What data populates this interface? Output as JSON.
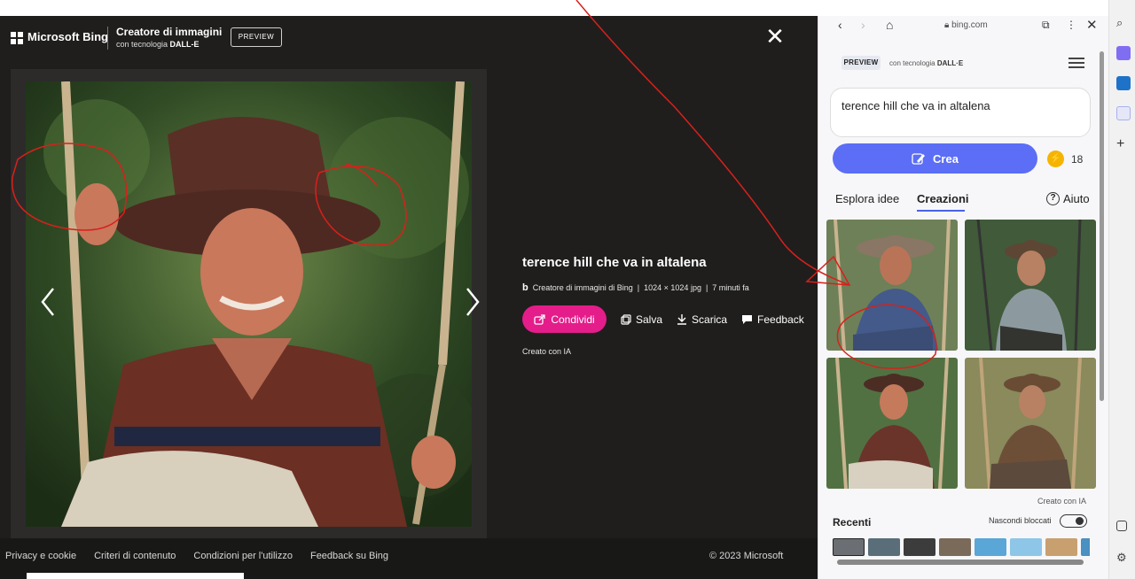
{
  "viewer": {
    "brand": "Microsoft Bing",
    "creator_title": "Creatore di immagini",
    "creator_sub_prefix": "con tecnologia ",
    "creator_sub_bold": "DALL-E",
    "preview": "PREVIEW",
    "close": "✕",
    "image_title": "terence hill che va in altalena",
    "meta_source": "Creatore di immagini di Bing",
    "meta_sep": "|",
    "meta_size": "1024 × 1024 jpg",
    "meta_time": "7 minuti fa",
    "actions": {
      "share": "Condividi",
      "save": "Salva",
      "download": "Scarica",
      "feedback": "Feedback"
    },
    "created_with": "Creato con IA",
    "bing_watermark": "b"
  },
  "footer": {
    "links": [
      "Privacy e cookie",
      "Criteri di contenuto",
      "Condizioni per l'utilizzo",
      "Feedback su Bing"
    ],
    "copyright": "© 2023 Microsoft"
  },
  "sidepanel": {
    "url": "bing.com",
    "preview": "PREVIEW",
    "dalle_prefix": "con tecnologia ",
    "dalle_bold": "DALL·E",
    "prompt": "terence hill che va in altalena",
    "create_label": "Crea",
    "boosts": "18",
    "tabs": {
      "explore": "Esplora idee",
      "creations": "Creazioni",
      "help": "Aiuto"
    },
    "created_with": "Creato con IA",
    "recent_title": "Recenti",
    "hide_blocked": "Nascondi bloccati"
  },
  "colors": {
    "share_button": "#e41d8a",
    "create_button": "#5b6ef5",
    "annotation_red": "#d8201c"
  },
  "icons": [
    "windows-logo-icon",
    "close-icon",
    "chevron-left-icon",
    "chevron-right-icon",
    "share-icon",
    "save-icon",
    "download-icon",
    "feedback-icon",
    "back-icon",
    "forward-icon",
    "home-icon",
    "lock-icon",
    "open-external-icon",
    "more-icon",
    "menu-icon",
    "create-icon",
    "boost-icon",
    "help-icon"
  ]
}
